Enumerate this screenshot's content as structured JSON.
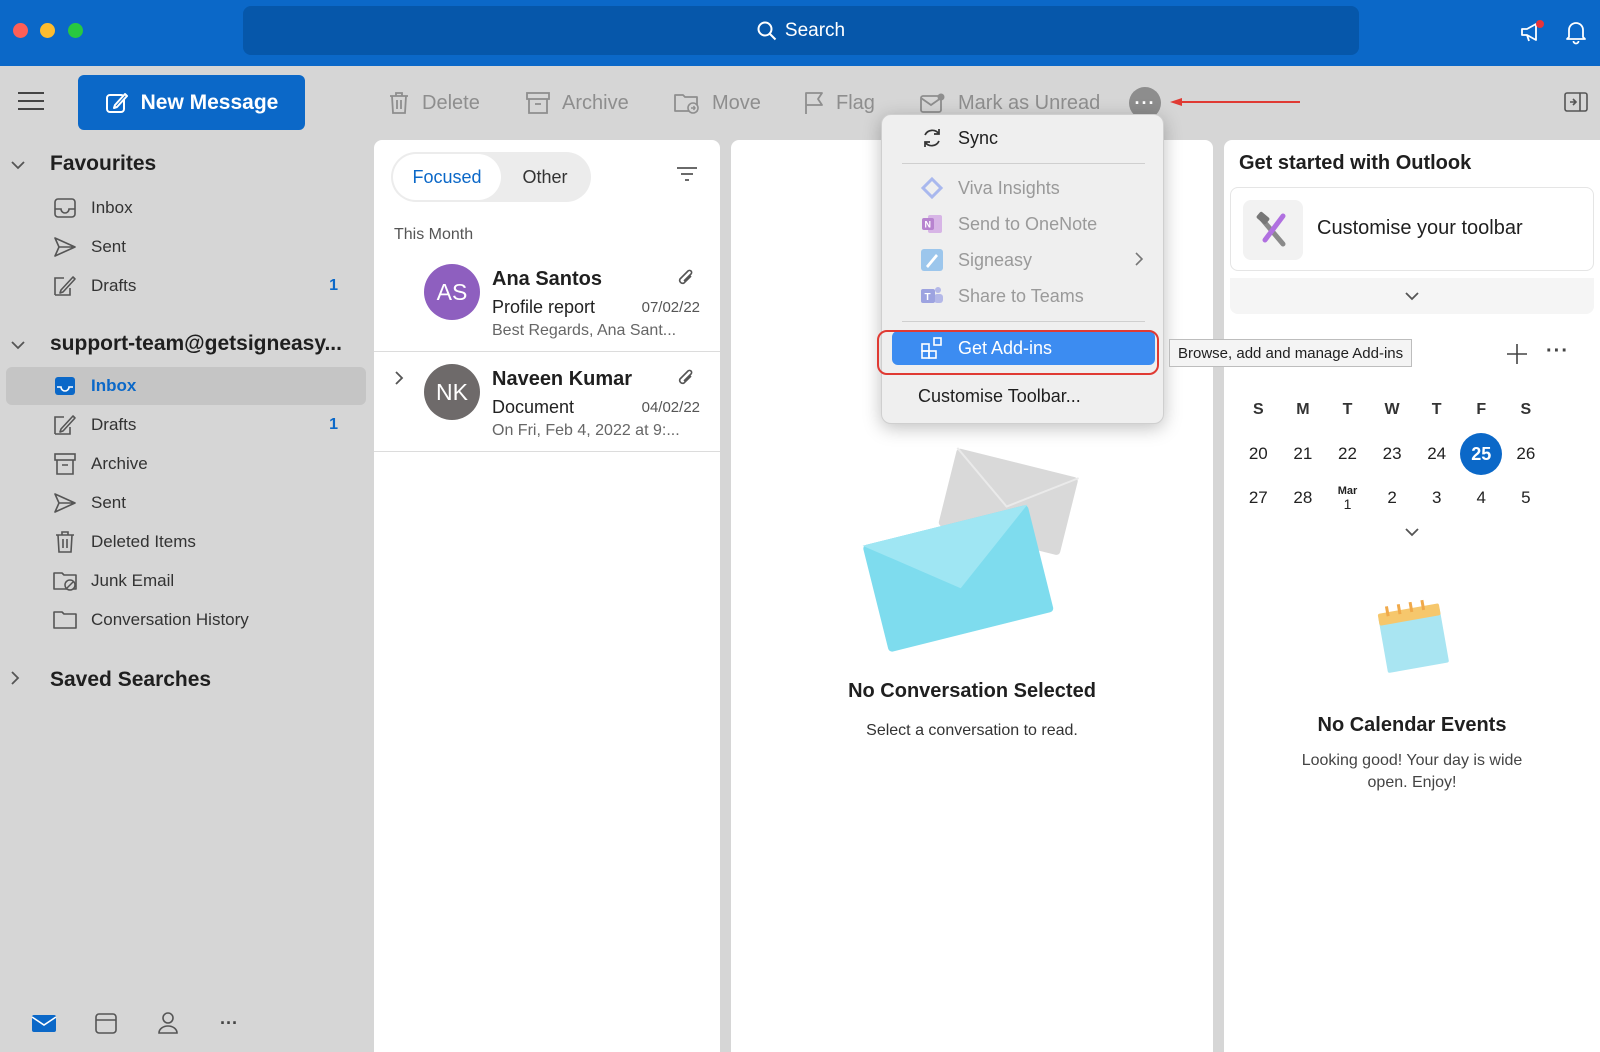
{
  "titlebar": {
    "search_label": "Search"
  },
  "toolbar": {
    "new_message": "New Message",
    "delete": "Delete",
    "archive": "Archive",
    "move": "Move",
    "flag": "Flag",
    "mark_unread": "Mark as Unread",
    "more": "···"
  },
  "sidebar": {
    "favourites": "Favourites",
    "fav_items": [
      {
        "label": "Inbox",
        "count": ""
      },
      {
        "label": "Sent",
        "count": ""
      },
      {
        "label": "Drafts",
        "count": "1"
      }
    ],
    "account": "support-team@getsigneasy...",
    "account_items": [
      {
        "label": "Inbox",
        "count": ""
      },
      {
        "label": "Drafts",
        "count": "1"
      },
      {
        "label": "Archive",
        "count": ""
      },
      {
        "label": "Sent",
        "count": ""
      },
      {
        "label": "Deleted Items",
        "count": ""
      },
      {
        "label": "Junk Email",
        "count": ""
      },
      {
        "label": "Conversation History",
        "count": ""
      }
    ],
    "saved_searches": "Saved Searches",
    "bottom_more": "···"
  },
  "message_list": {
    "tab_focused": "Focused",
    "tab_other": "Other",
    "group": "This Month",
    "messages": [
      {
        "initials": "AS",
        "from": "Ana Santos",
        "subject": "Profile report",
        "date": "07/02/22",
        "preview": "Best Regards, Ana Sant...",
        "avatar_color": "#8e5fbf"
      },
      {
        "initials": "NK",
        "from": "Naveen Kumar",
        "subject": "Document",
        "date": "04/02/22",
        "preview": "On Fri, Feb 4, 2022 at 9:...",
        "avatar_color": "#6e6a6a"
      }
    ]
  },
  "reading": {
    "title": "No Conversation Selected",
    "subtitle": "Select a conversation to read."
  },
  "menu": {
    "sync": "Sync",
    "viva": "Viva Insights",
    "onenote": "Send to OneNote",
    "signeasy": "Signeasy",
    "teams": "Share to Teams",
    "addins": "Get Add-ins",
    "customise": "Customise Toolbar...",
    "tooltip": "Browse, add and manage Add-ins"
  },
  "rightpane": {
    "title": "Get started with Outlook",
    "card": "Customise your toolbar",
    "cal_more": "···",
    "weekdays": [
      "S",
      "M",
      "T",
      "W",
      "T",
      "F",
      "S"
    ],
    "week1": [
      "20",
      "21",
      "22",
      "23",
      "24",
      "25",
      "26"
    ],
    "week2": [
      "27",
      "28",
      "1",
      "2",
      "3",
      "4",
      "5"
    ],
    "week2_month": "Mar",
    "today": "25",
    "no_events_title": "No Calendar Events",
    "no_events_sub": "Looking good! Your day is wide open. Enjoy!"
  },
  "colors": {
    "accent": "#0b68c8",
    "highlight": "#3c8cf1",
    "annotation": "#e03a33"
  }
}
